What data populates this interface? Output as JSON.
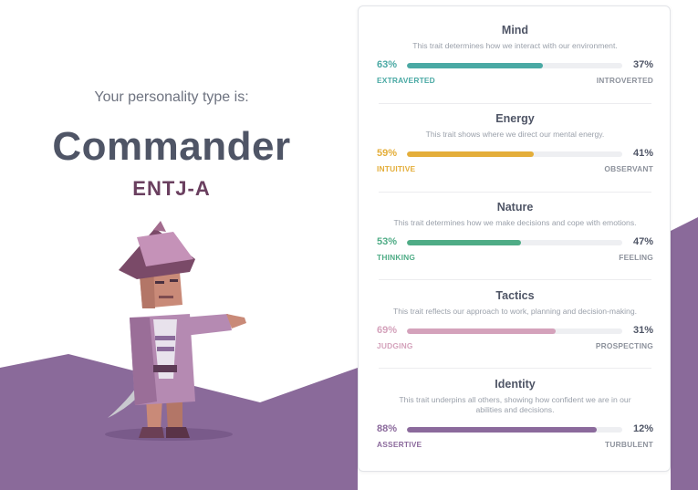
{
  "header": {
    "intro": "Your personality type is:",
    "type_name": "Commander",
    "type_code": "ENTJ-A"
  },
  "traits": [
    {
      "title": "Mind",
      "description": "This trait determines how we interact with our environment.",
      "left_pct": "63%",
      "right_pct": "37%",
      "left_label": "EXTRAVERTED",
      "right_label": "INTROVERTED",
      "value": 63,
      "color": "#4aa9a4"
    },
    {
      "title": "Energy",
      "description": "This trait shows where we direct our mental energy.",
      "left_pct": "59%",
      "right_pct": "41%",
      "left_label": "INTUITIVE",
      "right_label": "OBSERVANT",
      "value": 59,
      "color": "#e4ae3a"
    },
    {
      "title": "Nature",
      "description": "This trait determines how we make decisions and cope with emotions.",
      "left_pct": "53%",
      "right_pct": "47%",
      "left_label": "THINKING",
      "right_label": "FEELING",
      "value": 53,
      "color": "#4fac86"
    },
    {
      "title": "Tactics",
      "description": "This trait reflects our approach to work, planning and decision-making.",
      "left_pct": "69%",
      "right_pct": "31%",
      "left_label": "JUDGING",
      "right_label": "PROSPECTING",
      "value": 69,
      "color": "#d4a2bb"
    },
    {
      "title": "Identity",
      "description": "This trait underpins all others, showing how confident we are in our abilities and decisions.",
      "left_pct": "88%",
      "right_pct": "12%",
      "left_label": "ASSERTIVE",
      "right_label": "TURBULENT",
      "value": 88,
      "color": "#8b6a9c"
    }
  ],
  "colors": {
    "mountain": "#8a6a9a",
    "accent_text": "#6a3f5f"
  },
  "illustration": "commander-character"
}
